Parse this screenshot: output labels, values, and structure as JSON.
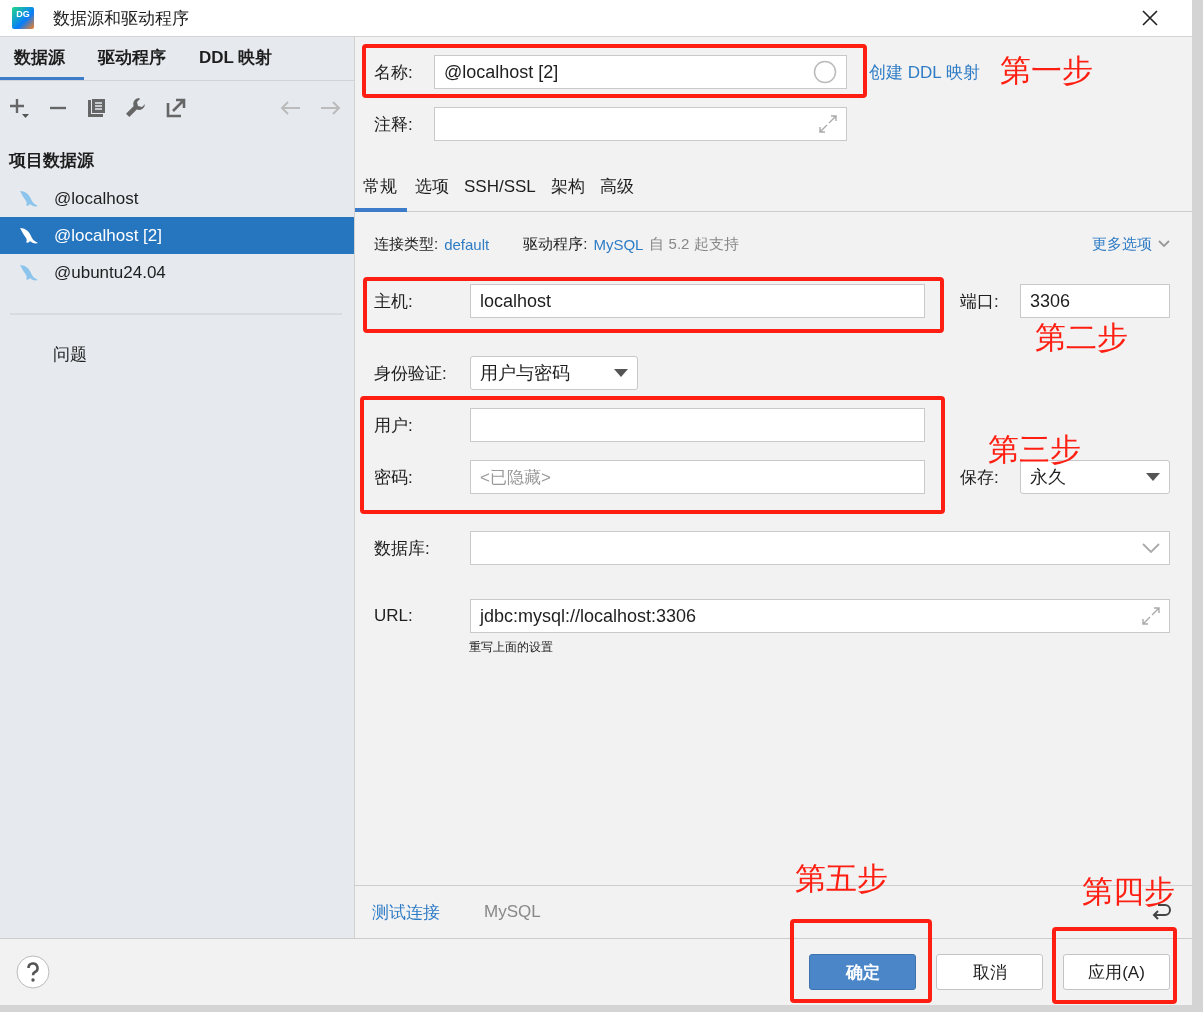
{
  "window": {
    "title": "数据源和驱动程序",
    "logo_text": "DG"
  },
  "left_tabs": [
    {
      "label": "数据源",
      "selected": true
    },
    {
      "label": "驱动程序",
      "selected": false
    },
    {
      "label": "DDL 映射",
      "selected": false
    }
  ],
  "sidebar": {
    "heading": "项目数据源",
    "items": [
      {
        "label": "@localhost",
        "selected": false
      },
      {
        "label": "@localhost [2]",
        "selected": true
      },
      {
        "label": "@ubuntu24.04",
        "selected": false
      }
    ],
    "problems": "问题"
  },
  "name": {
    "label": "名称:",
    "value": "@localhost [2]",
    "link": "创建 DDL 映射",
    "annotation": "第一步"
  },
  "comment": {
    "label": "注释:"
  },
  "tabs": [
    {
      "label": "常规",
      "selected": true
    },
    {
      "label": "选项",
      "selected": false
    },
    {
      "label": "SSH/SSL",
      "selected": false
    },
    {
      "label": "架构",
      "selected": false
    },
    {
      "label": "高级",
      "selected": false
    }
  ],
  "info": {
    "conn_type_label": "连接类型:",
    "conn_type": "default",
    "driver_label": "驱动程序:",
    "driver": "MySQL",
    "driver_note": "自 5.2 起支持",
    "more_options": "更多选项"
  },
  "host": {
    "label": "主机:",
    "value": "localhost",
    "annotation": "第二步"
  },
  "port": {
    "label": "端口:",
    "value": "3306"
  },
  "auth": {
    "label": "身份验证:",
    "value": "用户与密码"
  },
  "credentials": {
    "user_label": "用户:",
    "password_label": "密码:",
    "password_placeholder": "<已隐藏>",
    "annotation": "第三步"
  },
  "save": {
    "label": "保存:",
    "value": "永久"
  },
  "database": {
    "label": "数据库:"
  },
  "url": {
    "label": "URL:",
    "value": "jdbc:mysql://localhost:3306",
    "note": "重写上面的设置"
  },
  "footer": {
    "test_link": "测试连接",
    "driver": "MySQL"
  },
  "buttons": [
    {
      "label": "确定",
      "kind": "primary",
      "annotation": "第五步"
    },
    {
      "label": "取消",
      "kind": "default"
    },
    {
      "label": "应用(A)",
      "kind": "default",
      "annotation": "第四步"
    }
  ]
}
